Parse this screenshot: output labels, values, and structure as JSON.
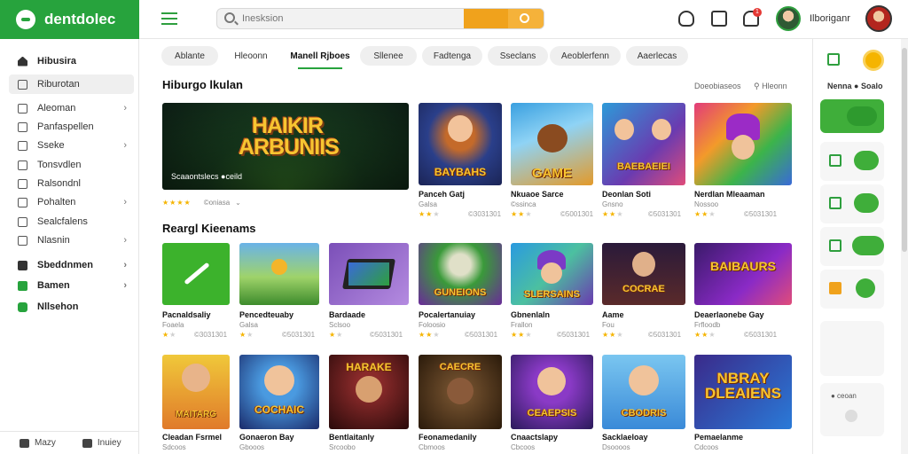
{
  "app": {
    "logo_text": "dentdolec",
    "brand_color": "#27a33d",
    "accent_color": "#f0a21c"
  },
  "header": {
    "search_placeholder": "Inesksion",
    "username": "Ilboriganr",
    "notification_count": "1"
  },
  "sidebar": {
    "items": [
      {
        "label": "Hibusira",
        "icon": "home-icon"
      },
      {
        "label": "Riburotan",
        "icon": "bookmark-icon"
      },
      {
        "label": "Aleoman",
        "icon": "grid-icon",
        "chevron": "›"
      },
      {
        "label": "Panfaspellen",
        "icon": "grid-icon"
      },
      {
        "label": "Sseke",
        "icon": "grid-icon",
        "chevron": "›"
      },
      {
        "label": "Tonsvdlen",
        "icon": "grid-icon"
      },
      {
        "label": "Ralsondnl",
        "icon": "grid-icon"
      },
      {
        "label": "Pohalten",
        "icon": "grid-icon",
        "chevron": "›"
      },
      {
        "label": "Sealcfalens",
        "icon": "grid-icon"
      },
      {
        "label": "Nlasnin",
        "icon": "grid-icon",
        "chevron": "›"
      },
      {
        "label": "Sbeddnmen",
        "icon": "grid-icon",
        "chevron": "›"
      },
      {
        "label": "Bamen",
        "icon": "list-icon",
        "chevron": "›"
      },
      {
        "label": "Nllsehon",
        "icon": "green-icon"
      }
    ],
    "footer": [
      {
        "label": "Mazy",
        "icon": "chat-icon"
      },
      {
        "label": "Inuiey",
        "icon": "user-icon"
      }
    ]
  },
  "tabs": [
    "Ablante",
    "Hleoonn",
    "Manell Rjboes",
    "Sllenee",
    "Fadtenga",
    "Sseclans",
    "Aeoblerfenn",
    "Aaerlecas"
  ],
  "sections": {
    "featured_title": "Hiburgo lkulan",
    "featured_meta": "Doeobiaseos",
    "featured_meta2": "Hleonn",
    "popular_title": "Reargl Kieenams"
  },
  "featured": {
    "art_title": "HAIKIR ARBUNIIS",
    "caption": "Scaaontslecs ●ceild",
    "rating_text": "©oniasa",
    "stars": 4
  },
  "games_row1": [
    {
      "title": "Panceh Gatj",
      "sub": "Galsa",
      "art": "BAYBAHS",
      "stars": 3,
      "meta": "©3031301"
    },
    {
      "title": "Nkuaoe Sarce",
      "sub": "©ssinca",
      "art": "GAME",
      "stars": 3,
      "meta": "©5001301"
    },
    {
      "title": "Deonlan Soti",
      "sub": "Gnsno",
      "art": "BAEBAEIEI",
      "stars": 3,
      "meta": "©5031301"
    },
    {
      "title": "Nerdlan Mleaaman",
      "sub": "Nossoo",
      "art": "",
      "stars": 3,
      "meta": "©5031301"
    }
  ],
  "games_row2": [
    {
      "title": "Pacnaldsaliy",
      "sub": "Foaela",
      "art": "",
      "stars": 3,
      "meta": "©3031301"
    },
    {
      "title": "Pencedteuaby",
      "sub": "Galsa",
      "art": "",
      "stars": 3,
      "meta": "©5031301"
    },
    {
      "title": "Bardaade",
      "sub": "Sclsoo",
      "art": "",
      "stars": 3,
      "meta": "©5031301"
    },
    {
      "title": "Pocalertanuiay",
      "sub": "Foloosio",
      "art": "GUNEIONS",
      "stars": 3,
      "meta": "©5031301"
    },
    {
      "title": "Gbnenlaln",
      "sub": "Frallon",
      "art": "SLERSAINS",
      "stars": 3,
      "meta": "©5031301"
    },
    {
      "title": "Aame",
      "sub": "Fou",
      "art": "COCRAE",
      "stars": 3,
      "meta": "©5031301"
    },
    {
      "title": "Deaerlaonebe Gay",
      "sub": "Frfloodb",
      "art": "BAIBAURS",
      "stars": 3,
      "meta": "©5031301"
    }
  ],
  "games_row3": [
    {
      "title": "Cleadan Fsrmel",
      "sub": "Sdcoos",
      "art": "MAITARG"
    },
    {
      "title": "Gonaeron Bay",
      "sub": "Gbooos",
      "art": "COCHAIC"
    },
    {
      "title": "Bentlaitanly",
      "sub": "Srcoobo",
      "art": "HARAKE"
    },
    {
      "title": "Feonamedanily",
      "sub": "Cbmoos",
      "art": "CAECRE"
    },
    {
      "title": "Cnaactslapy",
      "sub": "Cbcoos",
      "art": "CEAEPSIS"
    },
    {
      "title": "Sacklaeloay",
      "sub": "Dsoooos",
      "art": "CBODRIS"
    },
    {
      "title": "Pemaelanme",
      "sub": "Cdcoos",
      "art": "NBRAY DLEAIENS"
    }
  ],
  "right_panel": {
    "label": "Nenna ● Soalo",
    "cards": [
      "",
      "",
      "",
      ""
    ],
    "promo_label": "● ceoan"
  }
}
